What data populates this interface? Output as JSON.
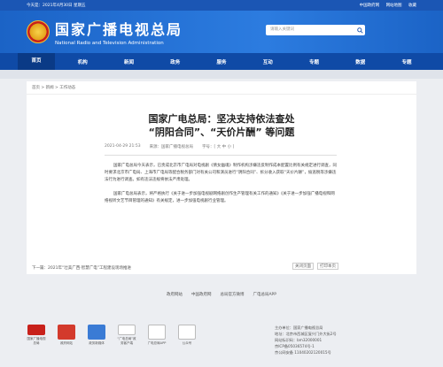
{
  "topbar": {
    "date": "今天是：2021年4月30日 星期五",
    "links": [
      "中国政府网",
      "网站地图",
      "收藏"
    ]
  },
  "header": {
    "title": "国家广播电视总局",
    "subtitle": "National Radio and Television Administration",
    "search_placeholder": "请输入关键词"
  },
  "nav": {
    "items": [
      "首页",
      "机构",
      "新闻",
      "政务",
      "服务",
      "互动",
      "专题",
      "数据",
      "专题"
    ],
    "active_index": 0
  },
  "breadcrumb": "首页 > 新闻 > 工作动态",
  "article": {
    "title_line1": "国家广电总局：坚决支持依法查处",
    "title_line2": "“阴阳合同”、“天价片酬” 等问题",
    "date": "2021-04-29 21:53",
    "source": "来源：国家广播电视总局",
    "font_size_label": "字号：[ 大 中 小 ]",
    "para1": "国家广电总局今天表示，已责成北京市广电局对电视剧《倩女幽魂》制作机构涉嫌违反制作成本配置比例有关规定进行调查，同时要求北京市广电局、上海市广电局等配合税务部门对有关公司和演员进行“阴阳合同”、拆分收入获取“天价片酬”，偷逃税等涉嫌违法行为进行调查。如有违法违规将依法严肃处理。",
    "para2": "国家广电总局表示，将严格执行《关于进一步加强电视剧网络剧创作生产管理有关工作的通知》《关于进一步加强广播电视和网络视听文艺节目管理的通知》有关规定，进一步加强电视剧行业管理。",
    "tools": [
      "关闭页面",
      "打印本页"
    ]
  },
  "related": "下一篇：2021年“壮美广西·智慧广电”工程建设现场推进",
  "footer": {
    "links": [
      "政府网站",
      "中国政府网",
      "总局官方微博",
      "广电总局APP"
    ],
    "icons": [
      "国家广播电视总局",
      "政府网站",
      "政务新媒体",
      "“广电总局”政务客户端",
      "广电总局APP",
      "公众号"
    ],
    "info": [
      "主办单位：国家广播电视总局",
      "地址：北京市西城区复兴门外大街2号",
      "网站标识码：bm32000001",
      "京ICP备05036574号-1",
      "京公网安备 11040202120015号"
    ]
  }
}
